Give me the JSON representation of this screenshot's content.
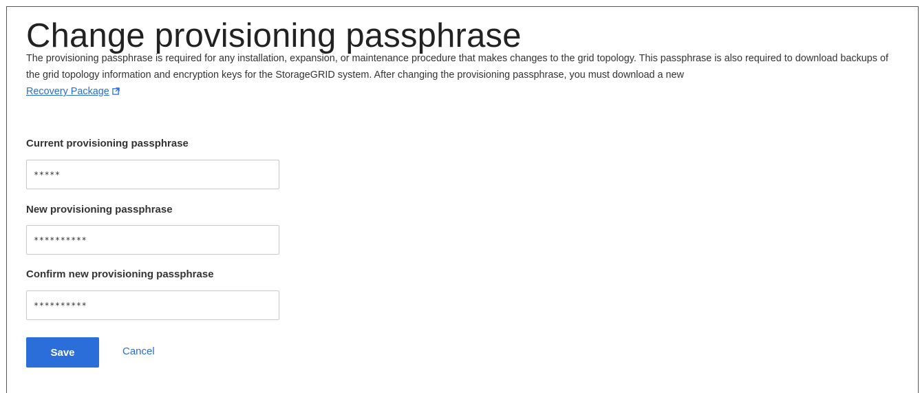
{
  "page": {
    "title": "Change provisioning passphrase",
    "description": "The provisioning passphrase is required for any installation, expansion, or maintenance procedure that makes changes to the grid topology. This passphrase is also required to download backups of the grid topology information and encryption keys for the StorageGRID system. After changing the provisioning passphrase, you must download a new",
    "recovery_link": "Recovery Package",
    "recovery_link_icon": "external-link-icon"
  },
  "form": {
    "current": {
      "label": "Current provisioning passphrase",
      "value": "*****"
    },
    "new": {
      "label": "New provisioning passphrase",
      "value": "**********"
    },
    "confirm": {
      "label": "Confirm new provisioning passphrase",
      "value": "**********"
    }
  },
  "actions": {
    "save_label": "Save",
    "cancel_label": "Cancel"
  },
  "colors": {
    "primary": "#2b6ed9",
    "link": "#2a6ed3",
    "input_border": "#c7c7c7"
  }
}
